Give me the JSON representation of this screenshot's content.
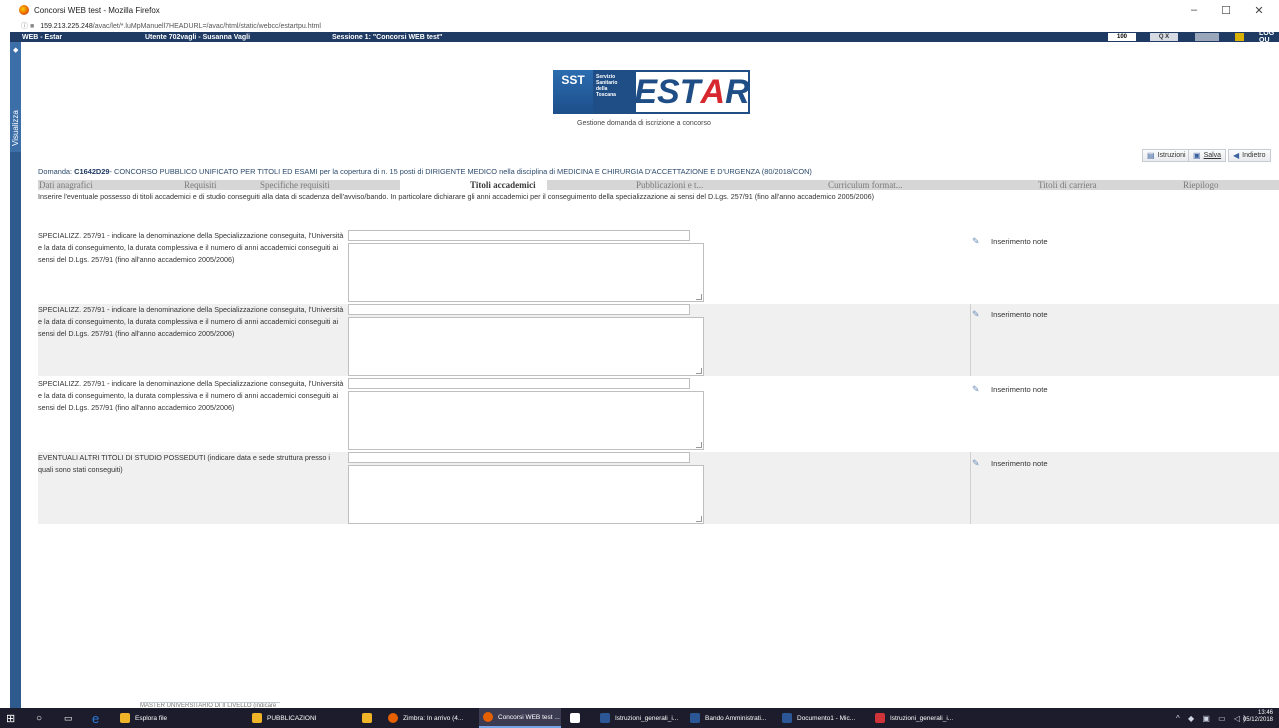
{
  "window": {
    "title": "Concorsi WEB test - Mozilla Firefox",
    "minimize": "–",
    "maximize": "☐",
    "close": "✕"
  },
  "browser": {
    "url_host": "159.213.225.248",
    "url_path": "/avac/let/*.luMpManuell7HEADURL=/avac/html/static/webcc/estartpu.html"
  },
  "appbar": {
    "app_name": "WEB - Estar",
    "user": "Utente 702vagli - Susanna Vagli",
    "session": "Sessione 1: \"Concorsi WEB test\"",
    "zoom": "100",
    "search": "Q X",
    "logout": "LOG OU"
  },
  "sidebar": {
    "label": "Visualizza",
    "pin": "◆"
  },
  "logo": {
    "sst": "SST",
    "sst_sub": "",
    "sst_lines": [
      "Servizio",
      "Sanitario",
      "della",
      "Toscana"
    ],
    "estar_main": "EST",
    "estar_accent": "A",
    "estar_tail": "R",
    "caption": "Gestione domanda di iscrizione a concorso"
  },
  "toolbar": {
    "istruzioni": "Istruzioni",
    "salva": "Salva",
    "indietro": "Indietro"
  },
  "domanda": {
    "prefix": "Domanda: ",
    "code": "C1642D29",
    "text": "- CONCORSO PUBBLICO UNIFICATO PER TITOLI ED ESAMI per la copertura di n. 15 posti di DIRIGENTE MEDICO nella disciplina di MEDICINA E CHIRURGIA D'ACCETTAZIONE E D'URGENZA (80/2018/CON)"
  },
  "tabs": [
    {
      "label": "Dati anagrafici"
    },
    {
      "label": "Requisiti"
    },
    {
      "label": "Specifiche requisiti"
    },
    {
      "label": "Titoli accademici"
    },
    {
      "label": "Pubblicazioni e t..."
    },
    {
      "label": "Curriculum format..."
    },
    {
      "label": "Titoli di carriera"
    },
    {
      "label": "Riepilogo"
    }
  ],
  "intro": "Inserire l'eventuale possesso di titoli accademici e di studio conseguiti alla data di scadenza dell'avviso/bando. In particolare dichiarare gli anni accademici per il conseguimento della specializzazione ai sensi del D.Lgs. 257/91 (fino all'anno accademico 2005/2006)",
  "sections": [
    {
      "label": "SPECIALIZZ. 257/91 - indicare la denominazione della Specializzazione conseguita, l'Università e la data di conseguimento, la durata complessiva e il numero di anni accademici conseguiti ai sensi del D.Lgs. 257/91 (fino all'anno accademico 2005/2006)",
      "input_value": "",
      "area_value": "",
      "note": "Inserimento note"
    },
    {
      "label": "SPECIALIZZ. 257/91 - indicare la denominazione della Specializzazione conseguita, l'Università e la data di conseguimento, la durata complessiva e il numero di anni accademici conseguiti ai sensi del D.Lgs. 257/91 (fino all'anno accademico 2005/2006)",
      "input_value": "",
      "area_value": "",
      "note": "Inserimento note"
    },
    {
      "label": "SPECIALIZZ. 257/91 - indicare la denominazione della Specializzazione conseguita, l'Università e la data di conseguimento, la durata complessiva e il numero di anni accademici conseguiti ai sensi del D.Lgs. 257/91 (fino all'anno accademico 2005/2006)",
      "input_value": "",
      "area_value": "",
      "note": "Inserimento note"
    },
    {
      "label": "EVENTUALI ALTRI TITOLI DI STUDIO POSSEDUTI (indicare data e sede struttura presso i quali sono stati conseguiti)",
      "input_value": "",
      "area_value": "",
      "note": "Inserimento note"
    }
  ],
  "partial_label": "MASTER UNIVERSITARIO DI II LIVELLO (indicare",
  "taskbar": {
    "items": [
      {
        "label": "Esplora file",
        "color": "#f0b429"
      },
      {
        "label": "PUBBLICAZIONI",
        "color": "#f0b429"
      },
      {
        "label": "",
        "color": "#f0b429"
      },
      {
        "label": "Zimbra: In arrivo (4...",
        "color": "#2b7de0"
      },
      {
        "label": "Concorsi WEB test ...",
        "color": "#e66000"
      },
      {
        "label": "",
        "color": "#ffffff"
      },
      {
        "label": "Istruzioni_generali_i...",
        "color": "#2b5797"
      },
      {
        "label": "Bando Amministrati...",
        "color": "#2b5797"
      },
      {
        "label": "Documento1 - Mic...",
        "color": "#2b5797"
      },
      {
        "label": "Istruzioni_generali_i...",
        "color": "#d13438"
      }
    ],
    "time": "13:46",
    "date": "05/12/2018"
  }
}
